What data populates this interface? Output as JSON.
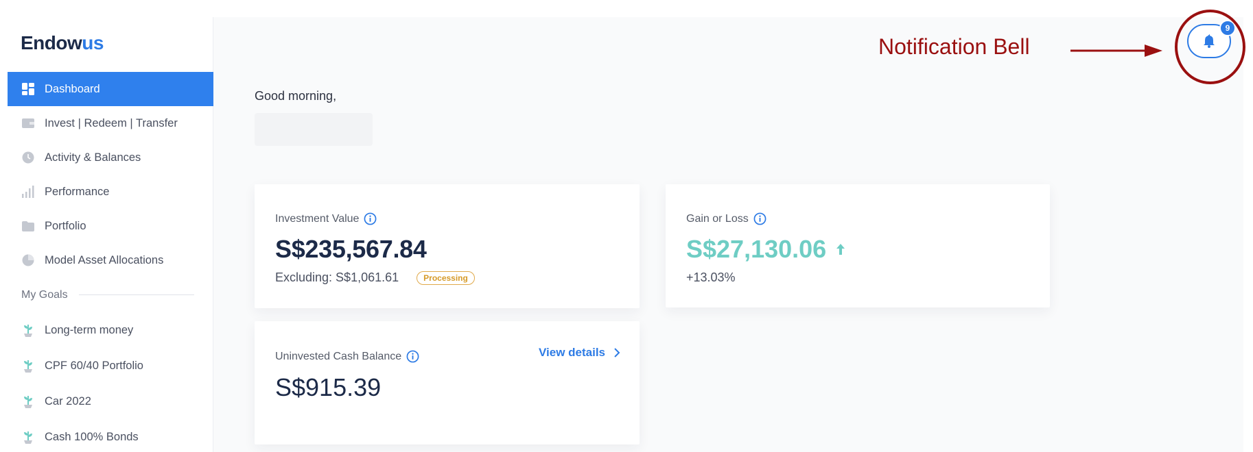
{
  "brand": {
    "name_main": "Endow",
    "name_accent": "us",
    "accent_color": "#2d7be5"
  },
  "sidebar": {
    "items": [
      {
        "label": "Dashboard",
        "icon": "dashboard-icon",
        "active": true
      },
      {
        "label": "Invest | Redeem | Transfer",
        "icon": "wallet-icon"
      },
      {
        "label": "Activity & Balances",
        "icon": "clock-icon"
      },
      {
        "label": "Performance",
        "icon": "bar-chart-icon"
      },
      {
        "label": "Portfolio",
        "icon": "folder-icon"
      },
      {
        "label": "Model Asset Allocations",
        "icon": "pie-chart-icon"
      }
    ],
    "goals_section_label": "My Goals",
    "goals": [
      {
        "label": "Long-term money",
        "icon": "plant-icon"
      },
      {
        "label": "CPF 60/40 Portfolio",
        "icon": "plant-icon"
      },
      {
        "label": "Car 2022",
        "icon": "plant-icon"
      },
      {
        "label": "Cash 100% Bonds",
        "icon": "plant-icon"
      }
    ]
  },
  "main": {
    "greeting": "Good morning,",
    "investment": {
      "label": "Investment Value",
      "value": "S$235,567.84",
      "excluding": "Excluding: S$1,061.61",
      "badge": "Processing"
    },
    "gain": {
      "label": "Gain or Loss",
      "value": "S$27,130.06",
      "percent": "+13.03%",
      "color": "#6ecdc4"
    },
    "cash": {
      "label": "Uninvested Cash Balance",
      "value": "S$915.39",
      "link": "View details"
    }
  },
  "notifications": {
    "count": "9",
    "icon": "bell-icon"
  },
  "annotation": {
    "text": "Notification Bell",
    "color": "#9a1010"
  }
}
